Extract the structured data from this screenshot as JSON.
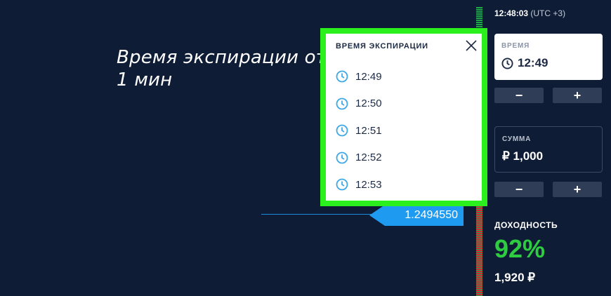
{
  "annotation": {
    "line1": "Время экспирации от",
    "line2": "1 мин"
  },
  "chart": {
    "current_price": "1.2494550"
  },
  "popup": {
    "title": "ВРЕМЯ ЭКСПИРАЦИИ",
    "close_icon": "close-icon",
    "items": [
      {
        "time": "12:49"
      },
      {
        "time": "12:50"
      },
      {
        "time": "12:51"
      },
      {
        "time": "12:52"
      },
      {
        "time": "12:53"
      }
    ],
    "highlight_color": "#2bf01e"
  },
  "sidebar": {
    "clock_time": "12:48:03",
    "timezone": "(UTC +3)",
    "time_field": {
      "label": "ВРЕМЯ",
      "value": "12:49"
    },
    "time_minus": "−",
    "time_plus": "+",
    "sum_field": {
      "label": "СУММА",
      "value": "₽ 1,000"
    },
    "sum_minus": "−",
    "sum_plus": "+",
    "profit": {
      "label": "ДОХОДНОСТЬ",
      "percent": "92%",
      "amount": "1,920 ₽"
    }
  },
  "colors": {
    "background": "#0f1c36",
    "accent_blue": "#1e9bf0",
    "profit_green": "#2ecc40"
  }
}
